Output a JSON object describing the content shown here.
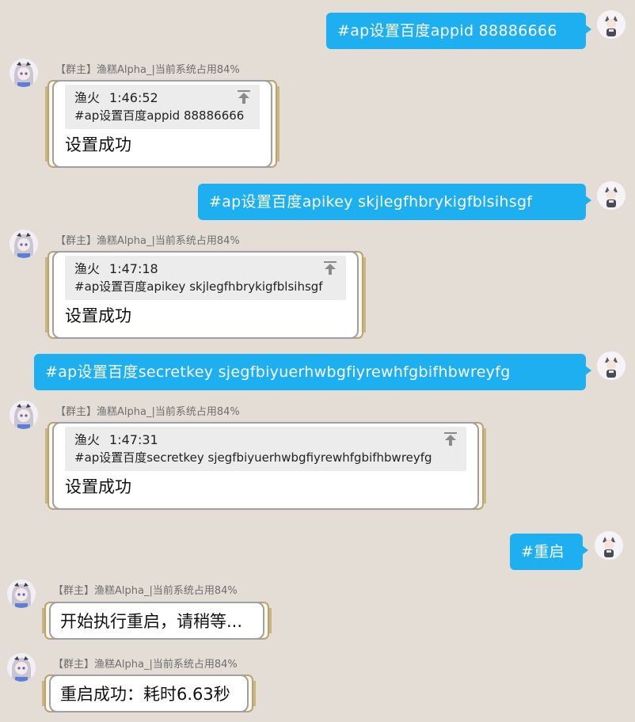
{
  "chat": {
    "messages": [
      {
        "kind": "out",
        "text": "#ap设置百度appid 88886666"
      },
      {
        "kind": "in",
        "sender": "【群主】渔糕Alpha_|当前系统占用84%",
        "quote": {
          "name": "渔火",
          "time": "1:46:52",
          "text": "#ap设置百度appid 88886666"
        },
        "reply": "设置成功"
      },
      {
        "kind": "out",
        "text": "#ap设置百度apikey skjlegfhbrykigfblsihsgf"
      },
      {
        "kind": "in",
        "sender": "【群主】渔糕Alpha_|当前系统占用84%",
        "quote": {
          "name": "渔火",
          "time": "1:47:18",
          "text": "#ap设置百度apikey skjlegfhbrykigfblsihsgf"
        },
        "reply": "设置成功"
      },
      {
        "kind": "out",
        "text": "#ap设置百度secretkey sjegfbiyuerhwbgfiyrewhfgbifhbwreyfg"
      },
      {
        "kind": "in",
        "sender": "【群主】渔糕Alpha_|当前系统占用84%",
        "quote": {
          "name": "渔火",
          "time": "1:47:31",
          "text": "#ap设置百度secretkey sjegfbiyuerhwbgfiyrewhfgbifhbwreyfg"
        },
        "reply": "设置成功"
      },
      {
        "kind": "out",
        "text": "#重启"
      },
      {
        "kind": "in",
        "sender": "【群主】渔糕Alpha_|当前系统占用84%",
        "reply": "开始执行重启，请稍等..."
      },
      {
        "kind": "in",
        "sender": "【群主】渔糕Alpha_|当前系统占用84%",
        "reply": "重启成功：耗时6.63秒"
      }
    ]
  },
  "icons": {
    "user_avatar": "user-avatar-icon",
    "bot_avatar": "bot-avatar-icon",
    "quote_jump": "jump-to-original-icon"
  },
  "colors": {
    "background": "#e3ddd6",
    "outgoing_bubble": "#1daff0",
    "incoming_card": "#ffffff",
    "frame_gold": "#b9a273"
  }
}
